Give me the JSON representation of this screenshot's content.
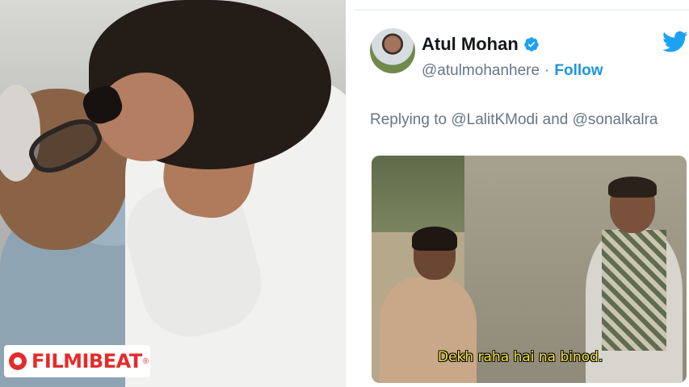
{
  "tweet": {
    "author_name": "Atul Mohan",
    "handle": "@atulmohanhere",
    "separator": "·",
    "follow_label": "Follow",
    "replying_prefix": "Replying to",
    "mention1": "@LalitKModi",
    "conjunction": "and",
    "mention2": "@sonalkalra"
  },
  "meme": {
    "caption": "Dekh raha hai na binod."
  },
  "watermark": {
    "text": "FILMIBEAT",
    "registered": "®"
  },
  "colors": {
    "accent": "#1b95e0",
    "twitter_blue": "#1da1f2",
    "text_primary": "#14171a",
    "text_secondary": "#657786",
    "logo_red": "#e32c2c",
    "caption_yellow": "#f7e83a"
  },
  "icons": {
    "verified": "verified-badge-icon",
    "twitter": "twitter-bird-icon"
  }
}
